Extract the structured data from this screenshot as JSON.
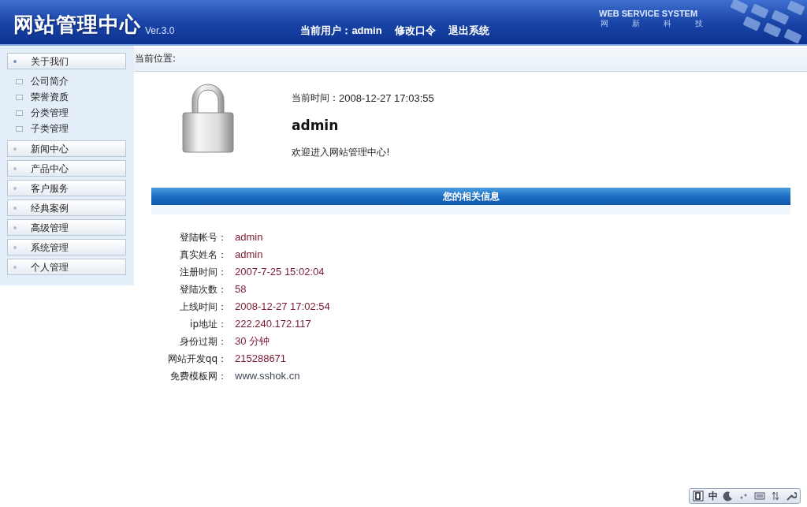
{
  "header": {
    "title": "网站管理中心",
    "version": "Ver.3.0",
    "current_user_label": "当前用户：",
    "current_user": "admin",
    "links": [
      "修改口令",
      "退出系统"
    ],
    "brand": "WEB SERVICE SYSTEM",
    "brand_sub": [
      "网",
      "新",
      "科",
      "技"
    ]
  },
  "sidebar": {
    "sections": [
      {
        "label": "关于我们",
        "expanded": true,
        "children": [
          {
            "label": "公司简介"
          },
          {
            "label": "荣誉资质"
          },
          {
            "label": "分类管理"
          },
          {
            "label": "子类管理"
          }
        ]
      },
      {
        "label": "新闻中心",
        "expanded": false
      },
      {
        "label": "产品中心",
        "expanded": false
      },
      {
        "label": "客户服务",
        "expanded": false
      },
      {
        "label": "经典案例",
        "expanded": false
      },
      {
        "label": "高级管理",
        "expanded": false
      },
      {
        "label": "系统管理",
        "expanded": false
      },
      {
        "label": "个人管理",
        "expanded": false
      }
    ]
  },
  "breadcrumb": "当前位置:",
  "welcome": {
    "time_label": "当前时间：",
    "time": "2008-12-27 17:03:55",
    "user": "admin",
    "message": "欢迎进入网站管理中心!"
  },
  "info": {
    "title": "您的相关信息",
    "rows": [
      {
        "label": "登陆帐号：",
        "value": "admin"
      },
      {
        "label": "真实姓名：",
        "value": "admin"
      },
      {
        "label": "注册时间：",
        "value": "2007-7-25 15:02:04"
      },
      {
        "label": "登陆次数：",
        "value": "58"
      },
      {
        "label": "上线时间：",
        "value": "2008-12-27 17:02:54"
      },
      {
        "label": "ip地址：",
        "value": "222.240.172.117"
      },
      {
        "label": "身份过期：",
        "value": "30 分钟"
      },
      {
        "label": "网站开发qq：",
        "value": "215288671"
      },
      {
        "label": "免费模板网：",
        "value": "www.sshok.cn",
        "kind": "link"
      }
    ]
  },
  "language_bar": {
    "mode": "中"
  }
}
